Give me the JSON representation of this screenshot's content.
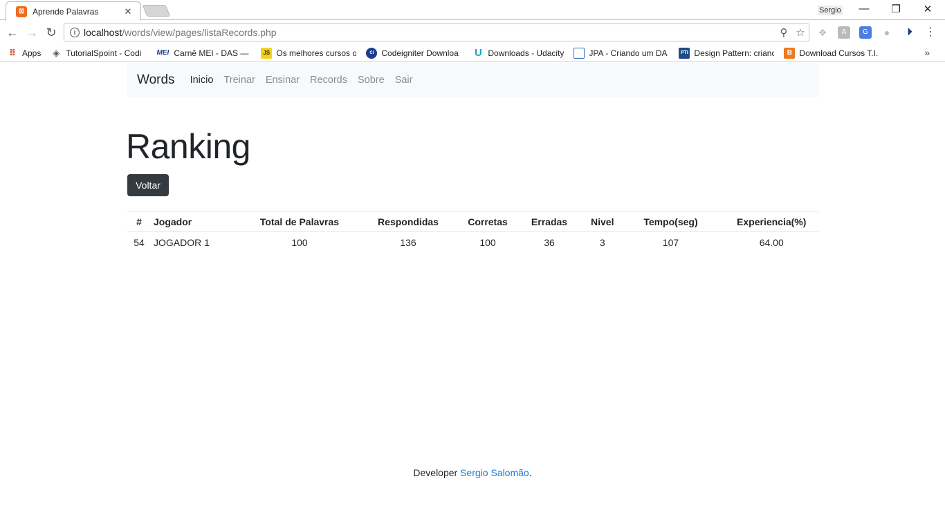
{
  "browser": {
    "tab_title": "Aprende Palavras",
    "profile_name": "Sergio",
    "url_host": "localhost",
    "url_path": "/words/view/pages/listaRecords.php",
    "bookmarks": [
      {
        "label": "Apps",
        "icon": "apps-grid-icon"
      },
      {
        "label": "TutorialSpoint - Codi",
        "icon": "tutorialspoint-icon"
      },
      {
        "label": "Carnê MEI - DAS — P",
        "icon": "mei-icon"
      },
      {
        "label": "Os melhores cursos o",
        "icon": "js-icon"
      },
      {
        "label": "Codeigniter Downloa",
        "icon": "codeigniter-icon"
      },
      {
        "label": "Downloads - Udacity",
        "icon": "udacity-icon"
      },
      {
        "label": "JPA - Criando um DA",
        "icon": "page-icon"
      },
      {
        "label": "Design Pattern: crianc",
        "icon": "pti-icon"
      },
      {
        "label": "Download Cursos T.I.",
        "icon": "blogger-icon"
      }
    ]
  },
  "nav": {
    "brand": "Words",
    "links": [
      "Inicio",
      "Treinar",
      "Ensinar",
      "Records",
      "Sobre",
      "Sair"
    ]
  },
  "main": {
    "heading": "Ranking",
    "back_button": "Voltar"
  },
  "table": {
    "headers": [
      "#",
      "Jogador",
      "Total de Palavras",
      "Respondidas",
      "Corretas",
      "Erradas",
      "Nivel",
      "Tempo(seg)",
      "Experiencia(%)"
    ],
    "rows": [
      [
        "54",
        "JOGADOR 1",
        "100",
        "136",
        "100",
        "36",
        "3",
        "107",
        "64.00"
      ]
    ]
  },
  "footer": {
    "prefix": "Developer ",
    "link_text": "Sergio Salomão",
    "suffix": "."
  },
  "colors": {
    "navbar_bg": "#f8f9fa",
    "button_bg": "#343a40",
    "link": "#1a7be0"
  }
}
